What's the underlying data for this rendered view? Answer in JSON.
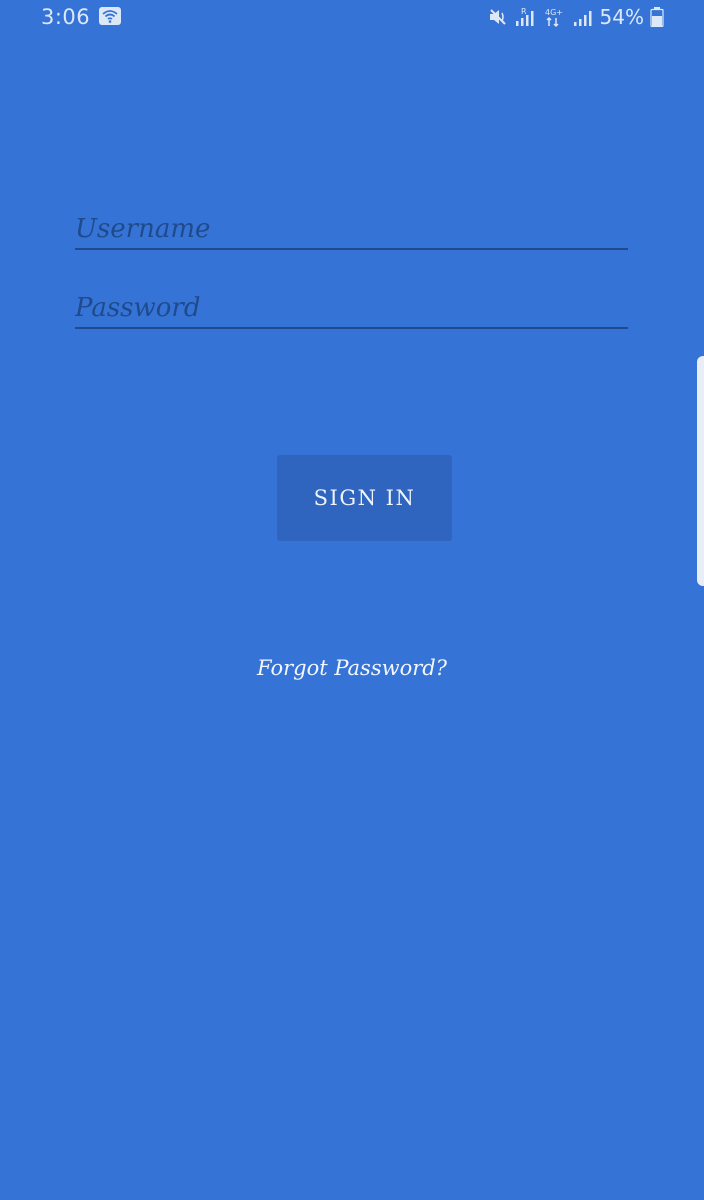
{
  "status_bar": {
    "time": "3:06",
    "battery_percent": "54%",
    "icons": [
      "wifi-icon",
      "mute-icon",
      "signal-roaming-icon",
      "data-4g-icon",
      "signal-icon",
      "battery-icon"
    ],
    "network_label": "4G+",
    "roaming_label": "R"
  },
  "login_form": {
    "username_placeholder": "Username",
    "username_value": "",
    "password_placeholder": "Password",
    "password_value": "",
    "sign_in_label": "SIGN IN",
    "forgot_password_label": "Forgot Password?"
  },
  "colors": {
    "background": "#3574d6",
    "button": "#2f65bf",
    "field_text": "#1f4a8c",
    "link_text": "#f2f6fd"
  }
}
